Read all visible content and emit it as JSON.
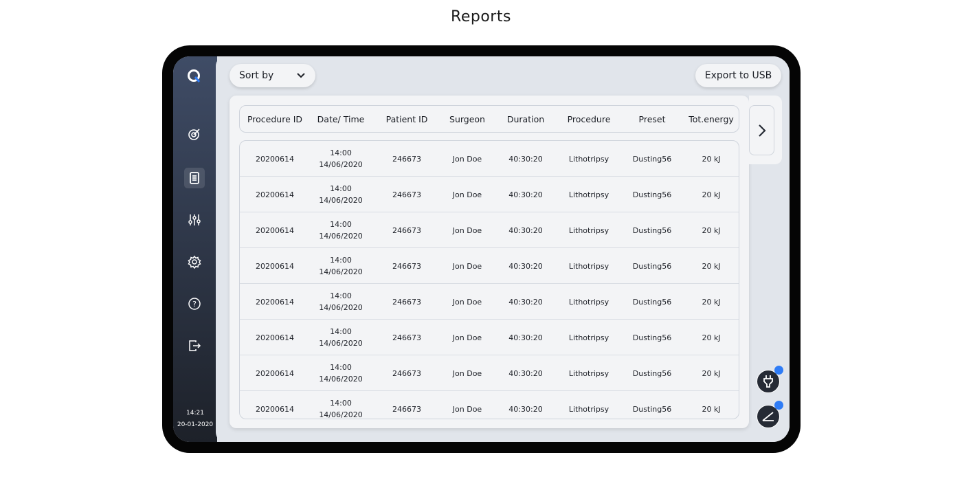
{
  "page_title": "Reports",
  "sidebar": {
    "items": [
      {
        "name": "logo",
        "icon": "q-logo-icon"
      },
      {
        "name": "target",
        "icon": "target-icon"
      },
      {
        "name": "reports",
        "icon": "document-icon",
        "active": true
      },
      {
        "name": "adjustments",
        "icon": "sliders-icon"
      },
      {
        "name": "settings",
        "icon": "gear-icon"
      },
      {
        "name": "help",
        "icon": "help-icon"
      },
      {
        "name": "logout",
        "icon": "logout-icon"
      }
    ],
    "time": "14:21",
    "date": "20-01-2020"
  },
  "toolbar": {
    "sort_label": "Sort by",
    "export_label": "Export to USB"
  },
  "table": {
    "columns": [
      "Procedure ID",
      "Date/ Time",
      "Patient ID",
      "Surgeon",
      "Duration",
      "Procedure",
      "Preset",
      "Tot.energy"
    ],
    "rows": [
      [
        "20200614",
        "14:00",
        "14/06/2020",
        "246673",
        "Jon Doe",
        "40:30:20",
        "Lithotripsy",
        "Dusting56",
        "20 kJ"
      ],
      [
        "20200614",
        "14:00",
        "14/06/2020",
        "246673",
        "Jon Doe",
        "40:30:20",
        "Lithotripsy",
        "Dusting56",
        "20 kJ"
      ],
      [
        "20200614",
        "14:00",
        "14/06/2020",
        "246673",
        "Jon Doe",
        "40:30:20",
        "Lithotripsy",
        "Dusting56",
        "20 kJ"
      ],
      [
        "20200614",
        "14:00",
        "14/06/2020",
        "246673",
        "Jon Doe",
        "40:30:20",
        "Lithotripsy",
        "Dusting56",
        "20 kJ"
      ],
      [
        "20200614",
        "14:00",
        "14/06/2020",
        "246673",
        "Jon Doe",
        "40:30:20",
        "Lithotripsy",
        "Dusting56",
        "20 kJ"
      ],
      [
        "20200614",
        "14:00",
        "14/06/2020",
        "246673",
        "Jon Doe",
        "40:30:20",
        "Lithotripsy",
        "Dusting56",
        "20 kJ"
      ],
      [
        "20200614",
        "14:00",
        "14/06/2020",
        "246673",
        "Jon Doe",
        "40:30:20",
        "Lithotripsy",
        "Dusting56",
        "20 kJ"
      ],
      [
        "20200614",
        "14:00",
        "14/06/2020",
        "246673",
        "Jon Doe",
        "40:30:20",
        "Lithotripsy",
        "Dusting56",
        "20 kJ"
      ]
    ]
  },
  "status": {
    "accent": "#2f7cf6",
    "power_icon": "plug-icon",
    "pedal_icon": "pedal-icon"
  }
}
